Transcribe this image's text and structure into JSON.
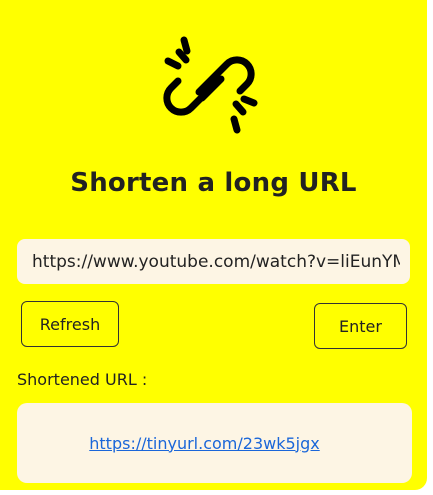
{
  "app": {
    "logo_icon": "broken-link-icon",
    "title": "Shorten a long URL",
    "background_color": "#ffff00",
    "panel_color": "#fdf5e4",
    "link_color": "#1a66d9"
  },
  "form": {
    "url_value": "https://www.youtube.com/watch?v=liEunYMBtVQ",
    "refresh_label": "Refresh",
    "enter_label": "Enter"
  },
  "result": {
    "label": "Shortened URL :",
    "link_text": "https://tinyurl.com/23wk5jgx"
  }
}
